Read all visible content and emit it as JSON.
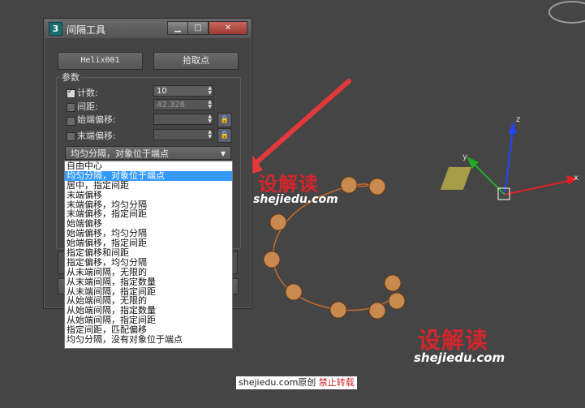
{
  "dialog": {
    "app_icon": "3",
    "title": "间隔工具",
    "window_buttons": {
      "minimize": "▁",
      "maximize": "□",
      "close": "✕"
    },
    "pick_object_label": "Helix001",
    "pick_points_label": "拾取点",
    "params_title": "参数",
    "count": {
      "label": "计数:",
      "value": "10",
      "checked": true
    },
    "spacing": {
      "label": "间距:",
      "value": "42.328",
      "checked": false
    },
    "start_offset": {
      "label": "始端偏移:",
      "checked": false
    },
    "end_offset": {
      "label": "末端偏移:",
      "checked": false
    },
    "distribution_selected": "均匀分隔，对象位于端点",
    "lock_icon": "lock-icon"
  },
  "dropdown_options": [
    "自由中心",
    "均匀分隔，对象位于端点",
    "居中，指定间距",
    "末端偏移",
    "末端偏移，均匀分隔",
    "末端偏移，指定间距",
    "始端偏移",
    "始端偏移，均匀分隔",
    "始端偏移，指定间距",
    "指定偏移和间距",
    "指定偏移，均匀分隔",
    "从末端间隔，无限的",
    "从末端间隔，指定数量",
    "从末端间隔，指定间距",
    "从始端间隔，无限的",
    "从始端间隔，指定数量",
    "从始端间隔，指定间距",
    "指定间距，匹配偏移",
    "均匀分隔，没有对象位于端点"
  ],
  "dropdown_selected_index": 1,
  "watermark": {
    "logo": "设解读",
    "url": "shejiedu.com"
  },
  "credit": {
    "text": "shejiedu.com原创",
    "warning": "禁止转载"
  },
  "gizmo": {
    "x": "x",
    "y": "y",
    "z": "z"
  },
  "colors": {
    "selection": "#3399ff",
    "watermark_red": "#d0262c",
    "arrow_red": "#e23a3a"
  }
}
